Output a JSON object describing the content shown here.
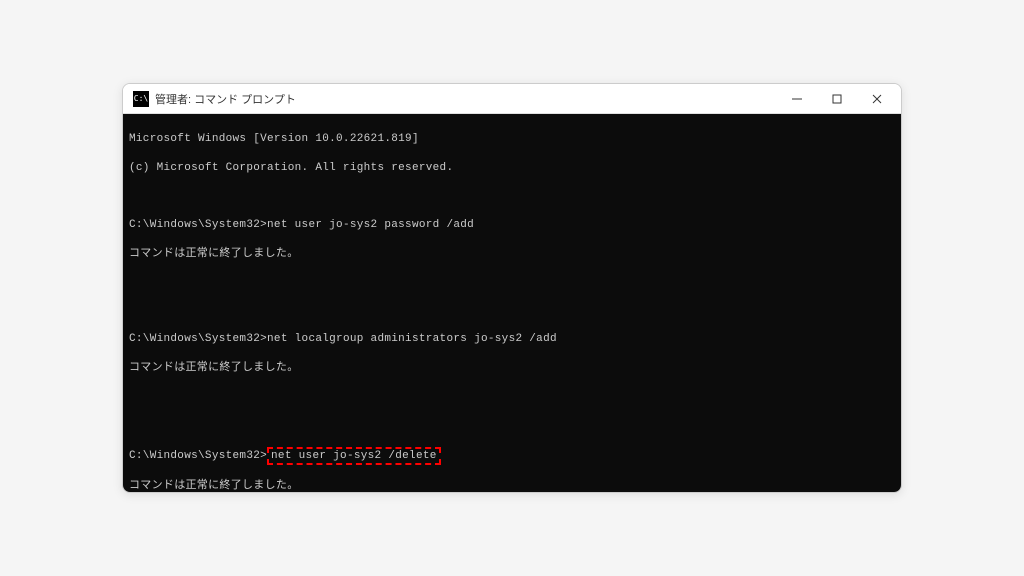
{
  "window": {
    "title": "管理者: コマンド プロンプト",
    "icon_text": "C:\\"
  },
  "terminal": {
    "version_line": "Microsoft Windows [Version 10.0.22621.819]",
    "copyright_line": "(c) Microsoft Corporation. All rights reserved.",
    "prompt": "C:\\Windows\\System32>",
    "cmd1": "net user jo-sys2 password /add",
    "success_msg": "コマンドは正常に終了しました。",
    "cmd2": "net localgroup administrators jo-sys2 /add",
    "cmd3": "net user jo-sys2 /delete",
    "success_msg_partial": "コマンドは正常に終了しました。"
  },
  "highlight": {
    "color": "#ff0000"
  }
}
